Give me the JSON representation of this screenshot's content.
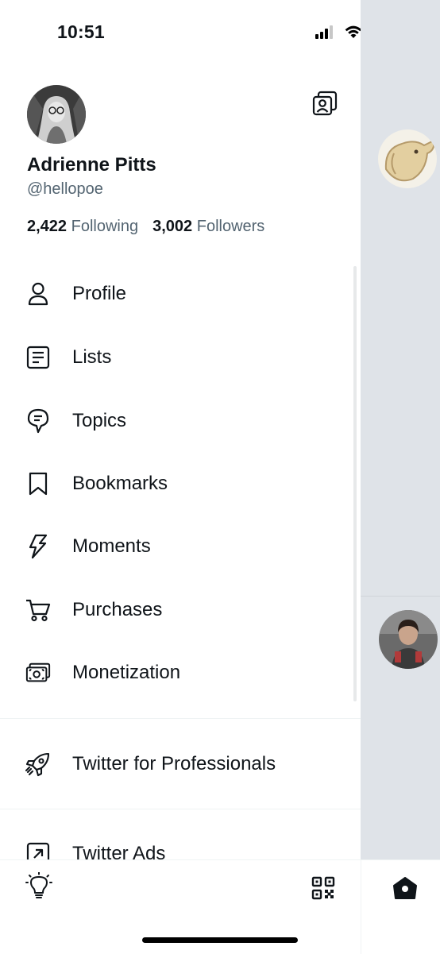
{
  "status_bar": {
    "time": "10:51"
  },
  "profile": {
    "display_name": "Adrienne Pitts",
    "handle": "@hellopoe",
    "following_count": "2,422",
    "following_label": "Following",
    "followers_count": "3,002",
    "followers_label": "Followers"
  },
  "menu": {
    "items": [
      {
        "label": "Profile",
        "icon": "person-icon"
      },
      {
        "label": "Lists",
        "icon": "list-icon"
      },
      {
        "label": "Topics",
        "icon": "topics-icon"
      },
      {
        "label": "Bookmarks",
        "icon": "bookmark-icon"
      },
      {
        "label": "Moments",
        "icon": "lightning-icon"
      },
      {
        "label": "Purchases",
        "icon": "cart-icon"
      },
      {
        "label": "Monetization",
        "icon": "money-icon"
      }
    ],
    "professionals": {
      "label": "Twitter for Professionals",
      "icon": "rocket-icon"
    },
    "ads": {
      "label": "Twitter Ads",
      "icon": "external-link-icon"
    }
  },
  "bottom_bar": {
    "left_icon": "lightbulb-icon",
    "right_icon": "qr-code-icon",
    "home_icon": "home-icon"
  },
  "colors": {
    "text": "#0f1419",
    "secondary": "#536471",
    "overlay": "#dfe3e8",
    "battery": "#f5c935"
  }
}
